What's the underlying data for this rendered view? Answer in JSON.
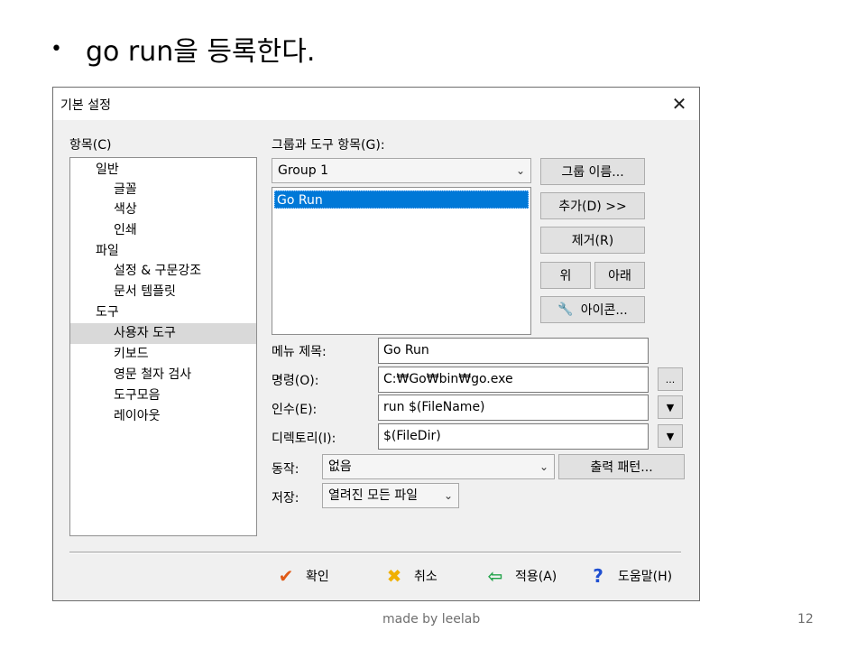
{
  "slide": {
    "bullet": "•",
    "heading": "go run을 등록한다.",
    "footer": "made by leelab",
    "page_number": "12"
  },
  "dialog": {
    "title": "기본 설정",
    "close_glyph": "✕",
    "tree_label": "항목(C)",
    "tree_items": [
      {
        "label": "일반"
      },
      {
        "label": "글꼴"
      },
      {
        "label": "색상"
      },
      {
        "label": "인쇄"
      },
      {
        "label": "파일"
      },
      {
        "label": "설정 & 구문강조"
      },
      {
        "label": "문서 템플릿"
      },
      {
        "label": "도구"
      },
      {
        "label": "사용자 도구"
      },
      {
        "label": "키보드"
      },
      {
        "label": "영문 철자 검사"
      },
      {
        "label": "도구모음"
      },
      {
        "label": "레이아웃"
      }
    ],
    "group_label": "그룹과 도구 항목(G):",
    "group_value": "Group 1",
    "tool_items": [
      "Go Run"
    ],
    "buttons": {
      "group_name": "그룹 이름...",
      "add": "추가(D) >>",
      "remove": "제거(R)",
      "up": "위",
      "down": "아래",
      "icon": "아이콘..."
    },
    "menu_title_label": "메뉴 제목:",
    "menu_title_value": "Go Run",
    "command_label": "명령(O):",
    "command_value": "C:₩Go₩bin₩go.exe",
    "browse_label": "...",
    "args_label": "인수(E):",
    "args_value": "run $(FileName)",
    "dir_label": "디렉토리(I):",
    "dir_value": "$(FileDir)",
    "dropdown_glyph": "▼",
    "action_label": "동작:",
    "action_value": "없음",
    "output_pattern": "출력 패턴...",
    "save_label": "저장:",
    "save_value": "열려진 모든 파일",
    "footer": {
      "ok": "확인",
      "cancel": "취소",
      "apply": "적용(A)",
      "help": "도움말(H)"
    },
    "icons": {
      "ok": "✔",
      "cancel": "✖",
      "apply": "⇦",
      "help": "?",
      "wrench": "🔧",
      "chevron": "⌄"
    }
  }
}
